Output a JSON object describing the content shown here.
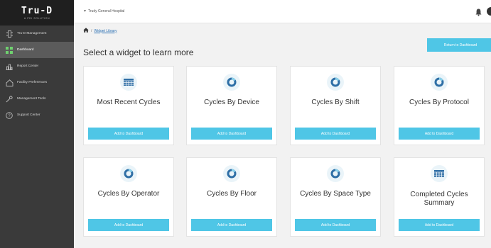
{
  "brand": {
    "name": "Tru-D",
    "tagline": "A PDI SOLUTION"
  },
  "sidebar": {
    "items": [
      {
        "label": "Tru-D Management",
        "icon": "tru-d-robot-icon",
        "active": false
      },
      {
        "label": "Dashboard",
        "icon": "dashboard-grid-icon",
        "active": true
      },
      {
        "label": "Report Center",
        "icon": "bar-chart-icon",
        "active": false
      },
      {
        "label": "Facility Preferences",
        "icon": "house-icon",
        "active": false
      },
      {
        "label": "Management Tools",
        "icon": "wrench-icon",
        "active": false
      },
      {
        "label": "Support Center",
        "icon": "question-circle-icon",
        "active": false
      }
    ]
  },
  "topbar": {
    "facility": "Trudy General Hospital"
  },
  "breadcrumb": {
    "current": "Widget Library"
  },
  "page": {
    "title": "Select a widget to learn more",
    "return_label": "Return to Dashboard"
  },
  "widgets": [
    {
      "title": "Most Recent Cycles",
      "icon": "table-icon",
      "add_label": "Add to Dashboard"
    },
    {
      "title": "Cycles By Device",
      "icon": "donut-chart-icon",
      "add_label": "Add to Dashboard"
    },
    {
      "title": "Cycles By Shift",
      "icon": "donut-chart-icon",
      "add_label": "Add to Dashboard"
    },
    {
      "title": "Cycles By Protocol",
      "icon": "donut-chart-icon",
      "add_label": "Add to Dashboard"
    },
    {
      "title": "Cycles By Operator",
      "icon": "donut-chart-icon",
      "add_label": "Add to Dashboard"
    },
    {
      "title": "Cycles By Floor",
      "icon": "donut-chart-icon",
      "add_label": "Add to Dashboard"
    },
    {
      "title": "Cycles By Space Type",
      "icon": "donut-chart-icon",
      "add_label": "Add to Dashboard"
    },
    {
      "title": "Completed Cycles Summary",
      "icon": "table-icon",
      "add_label": "Add to Dashboard"
    }
  ],
  "colors": {
    "accent": "#4fc6e6",
    "sidebar": "#3a3a3a",
    "sidebar_active": "#5b5b5b",
    "icon_blue": "#2f6fa6"
  }
}
